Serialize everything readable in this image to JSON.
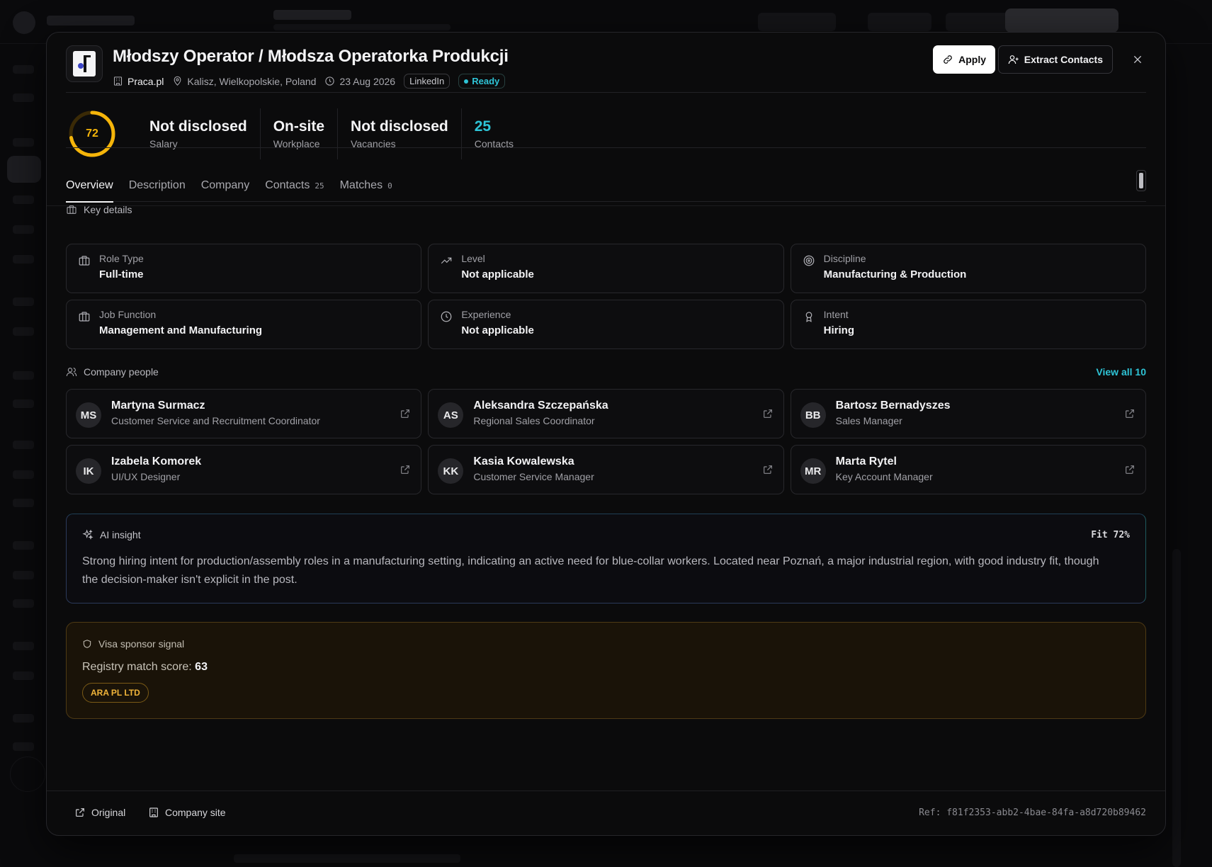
{
  "job": {
    "title": "Młodszy Operator / Młodsza Operatorka Produkcji",
    "company": "Praca.pl",
    "location": "Kalisz, Wielkopolskie, Poland",
    "date": "23 Aug 2026",
    "source_tag": "LinkedIn",
    "status": "Ready"
  },
  "actions": {
    "apply_label": "Apply",
    "extract_label": "Extract Contacts"
  },
  "stats": {
    "score": 72,
    "score_color": "#f5b50a",
    "items": [
      {
        "value": "Not disclosed",
        "label": "Salary"
      },
      {
        "value": "On-site",
        "label": "Workplace"
      },
      {
        "value": "Not disclosed",
        "label": "Vacancies"
      },
      {
        "value": "25",
        "label": "Contacts"
      }
    ]
  },
  "tabs": [
    {
      "label": "Overview",
      "count": ""
    },
    {
      "label": "Description",
      "count": ""
    },
    {
      "label": "Company",
      "count": ""
    },
    {
      "label": "Contacts",
      "count": "25"
    },
    {
      "label": "Matches",
      "count": "0"
    }
  ],
  "key_details": {
    "heading": "Key details",
    "items": [
      {
        "label": "Role Type",
        "value": "Full-time",
        "icon": "briefcase-icon"
      },
      {
        "label": "Level",
        "value": "Not applicable",
        "icon": "trending-up-icon"
      },
      {
        "label": "Discipline",
        "value": "Manufacturing & Production",
        "icon": "target-icon"
      },
      {
        "label": "Job Function",
        "value": "Management and Manufacturing",
        "icon": "briefcase-icon"
      },
      {
        "label": "Experience",
        "value": "Not applicable",
        "icon": "clock-icon"
      },
      {
        "label": "Intent",
        "value": "Hiring",
        "icon": "award-icon"
      }
    ]
  },
  "people": {
    "heading": "Company people",
    "view_all": "View all 10",
    "items": [
      {
        "initials": "MS",
        "name": "Martyna Surmacz",
        "role": "Customer Service and Recruitment Coordinator"
      },
      {
        "initials": "AS",
        "name": "Aleksandra Szczepańska",
        "role": "Regional Sales Coordinator"
      },
      {
        "initials": "BB",
        "name": "Bartosz Bernadyszes",
        "role": "Sales Manager"
      },
      {
        "initials": "IK",
        "name": "Izabela Komorek",
        "role": "UI/UX Designer"
      },
      {
        "initials": "KK",
        "name": "Kasia Kowalewska",
        "role": "Customer Service Manager"
      },
      {
        "initials": "MR",
        "name": "Marta Rytel",
        "role": "Key Account Manager"
      }
    ]
  },
  "insight": {
    "heading": "AI insight",
    "fit": "Fit 72%",
    "text": "Strong hiring intent for production/assembly roles in a manufacturing setting, indicating an active need for blue-collar workers. Located near Poznań, a major industrial region, with good industry fit, though the decision-maker isn't explicit in the post."
  },
  "visa": {
    "heading": "Visa sponsor signal",
    "score_label": "Registry match score:",
    "score": "63",
    "chip": "ARA PL LTD"
  },
  "footer": {
    "original": "Original",
    "company_site": "Company site",
    "ref": "Ref: f81f2353-abb2-4bae-84fa-a8d720b89462"
  },
  "colors": {
    "accent": "#2ec4d6",
    "warning": "#f5b50a",
    "visa_chip": "#f0b43a"
  }
}
